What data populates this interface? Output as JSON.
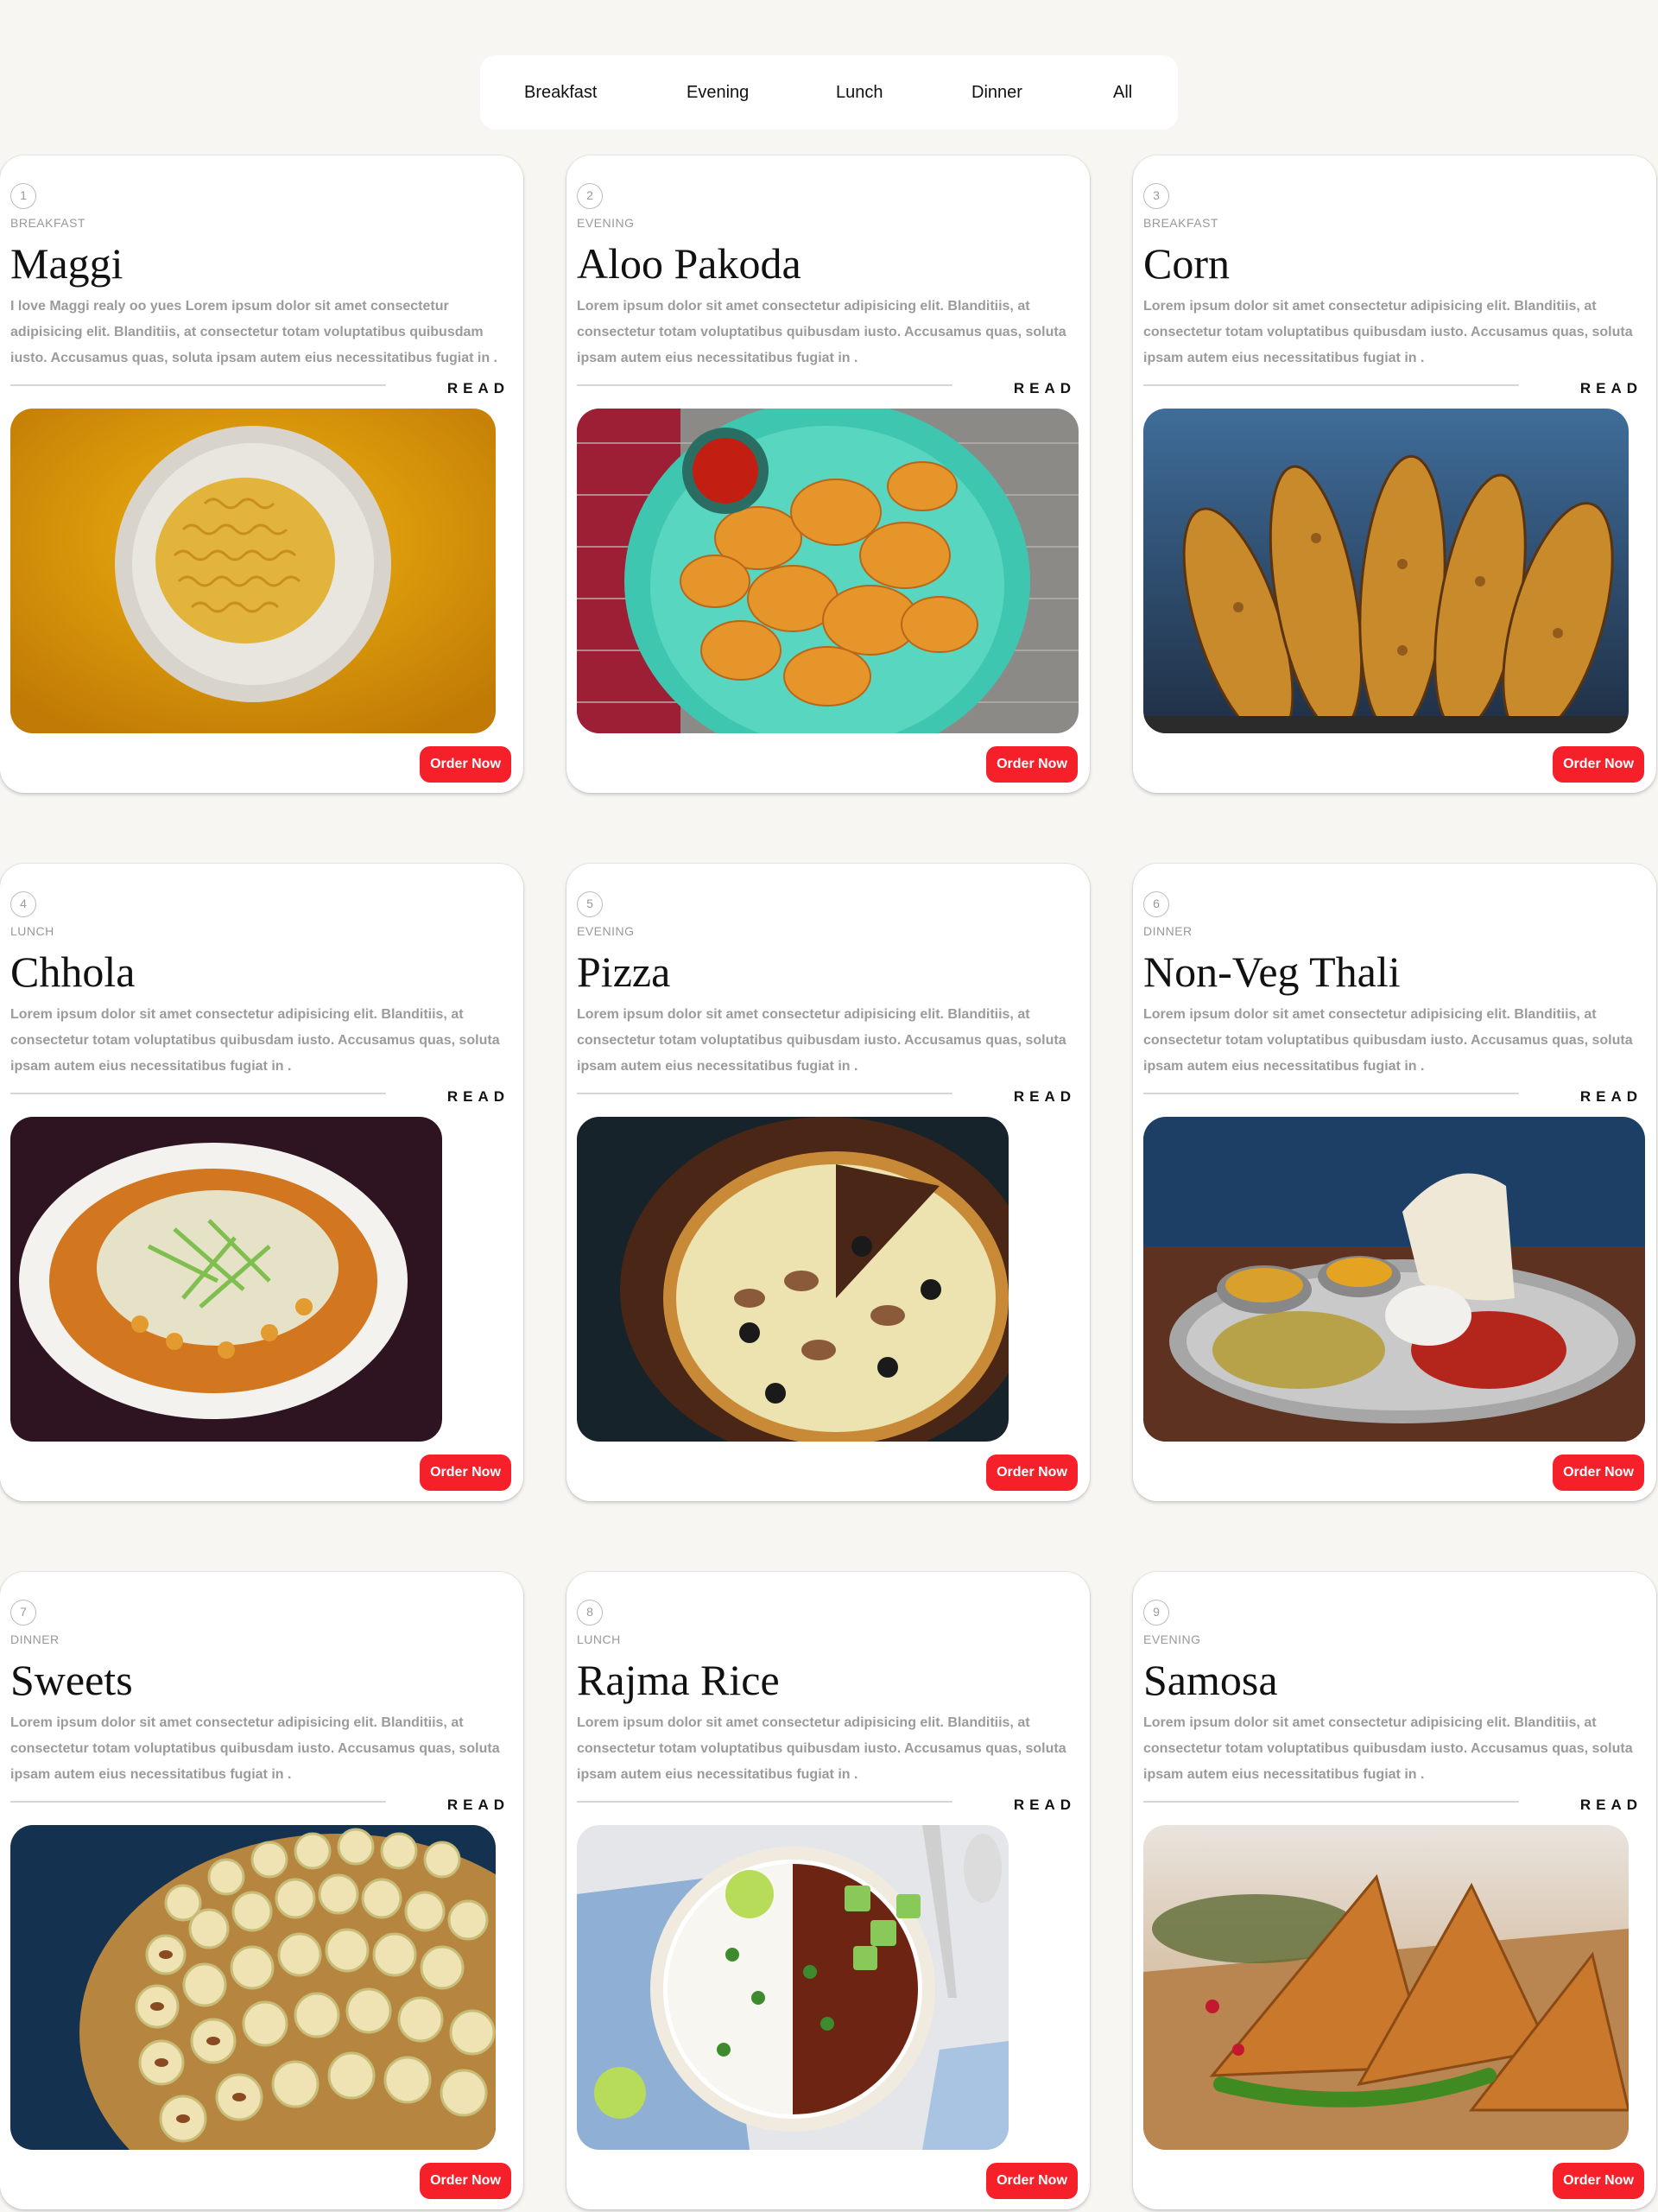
{
  "filters": [
    "Breakfast",
    "Evening",
    "Lunch",
    "Dinner",
    "All"
  ],
  "colors": {
    "accent": "#f5202a",
    "page_background": "#f8f6f2",
    "card_background": "#ffffff"
  },
  "cards": [
    {
      "number": "1",
      "category": "BREAKFAST",
      "title": "Maggi",
      "description": "I love Maggi realy oo yues Lorem ipsum dolor sit amet consectetur adipisicing elit. Blanditiis, at consectetur totam voluptatibus quibusdam iusto. Accusamus quas, soluta ipsam autem eius necessitatibus fugiat in .",
      "read_label": "READ",
      "order_label": "Order Now",
      "image": "maggi-noodles-plate-photo"
    },
    {
      "number": "2",
      "category": "EVENING",
      "title": "Aloo Pakoda",
      "description": "Lorem ipsum dolor sit amet consectetur adipisicing elit. Blanditiis, at consectetur totam voluptatibus quibusdam iusto. Accusamus quas, soluta ipsam autem eius necessitatibus fugiat in .",
      "read_label": "READ",
      "order_label": "Order Now",
      "image": "aloo-pakoda-plate-photo"
    },
    {
      "number": "3",
      "category": "BREAKFAST",
      "title": "Corn",
      "description": "Lorem ipsum dolor sit amet consectetur adipisicing elit. Blanditiis, at consectetur totam voluptatibus quibusdam iusto. Accusamus quas, soluta ipsam autem eius necessitatibus fugiat in .",
      "read_label": "READ",
      "order_label": "Order Now",
      "image": "roasted-corn-photo"
    },
    {
      "number": "4",
      "category": "LUNCH",
      "title": "Chhola",
      "description": "Lorem ipsum dolor sit amet consectetur adipisicing elit. Blanditiis, at consectetur totam voluptatibus quibusdam iusto. Accusamus quas, soluta ipsam autem eius necessitatibus fugiat in .",
      "read_label": "READ",
      "order_label": "Order Now",
      "image": "chhola-plate-photo"
    },
    {
      "number": "5",
      "category": "EVENING",
      "title": "Pizza",
      "description": "Lorem ipsum dolor sit amet consectetur adipisicing elit. Blanditiis, at consectetur totam voluptatibus quibusdam iusto. Accusamus quas, soluta ipsam autem eius necessitatibus fugiat in .",
      "read_label": "READ",
      "order_label": "Order Now",
      "image": "pizza-board-photo"
    },
    {
      "number": "6",
      "category": "DINNER",
      "title": "Non-Veg Thali",
      "description": "Lorem ipsum dolor sit amet consectetur adipisicing elit. Blanditiis, at consectetur totam voluptatibus quibusdam iusto. Accusamus quas, soluta ipsam autem eius necessitatibus fugiat in .",
      "read_label": "READ",
      "order_label": "Order Now",
      "image": "non-veg-thali-photo"
    },
    {
      "number": "7",
      "category": "DINNER",
      "title": "Sweets",
      "description": "Lorem ipsum dolor sit amet consectetur adipisicing elit. Blanditiis, at consectetur totam voluptatibus quibusdam iusto. Accusamus quas, soluta ipsam autem eius necessitatibus fugiat in .",
      "read_label": "READ",
      "order_label": "Order Now",
      "image": "sweets-tray-photo"
    },
    {
      "number": "8",
      "category": "LUNCH",
      "title": "Rajma Rice",
      "description": "Lorem ipsum dolor sit amet consectetur adipisicing elit. Blanditiis, at consectetur totam voluptatibus quibusdam iusto. Accusamus quas, soluta ipsam autem eius necessitatibus fugiat in .",
      "read_label": "READ",
      "order_label": "Order Now",
      "image": "rajma-rice-bowl-photo"
    },
    {
      "number": "9",
      "category": "EVENING",
      "title": "Samosa",
      "description": "Lorem ipsum dolor sit amet consectetur adipisicing elit. Blanditiis, at consectetur totam voluptatibus quibusdam iusto. Accusamus quas, soluta ipsam autem eius necessitatibus fugiat in .",
      "read_label": "READ",
      "order_label": "Order Now",
      "image": "samosa-board-photo"
    }
  ]
}
